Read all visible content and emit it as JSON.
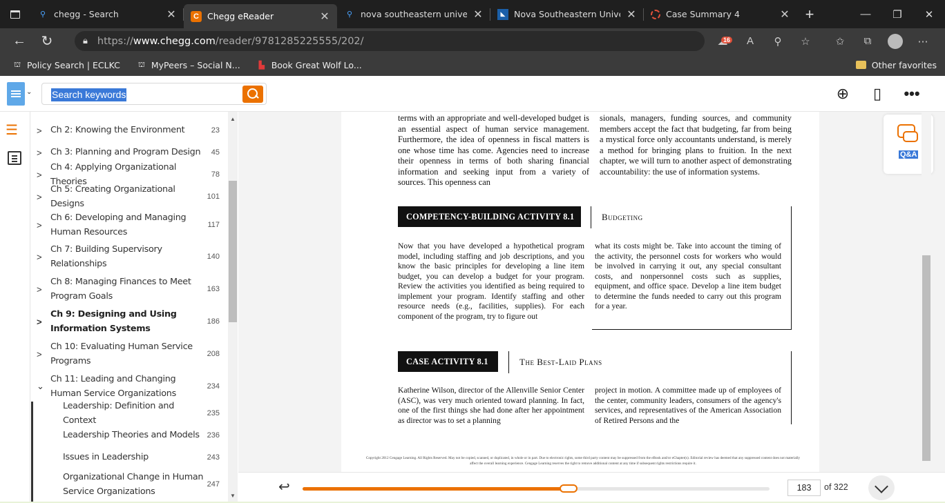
{
  "browser": {
    "tabs": [
      {
        "title": "chegg - Search",
        "icon": "search-icon",
        "active": false
      },
      {
        "title": "Chegg eReader",
        "icon": "chegg-logo-icon",
        "active": true
      },
      {
        "title": "nova southeastern university",
        "icon": "search-icon",
        "active": false
      },
      {
        "title": "Nova Southeastern University",
        "icon": "nsu-logo-icon",
        "active": false
      },
      {
        "title": "Case Summary 4",
        "icon": "loading-icon",
        "active": false
      }
    ],
    "url_prefix": "https://",
    "url_domain": "www.chegg.com",
    "url_path": "/reader/9781285225555/202/",
    "extension_badge": "16",
    "favorites": [
      {
        "label": "Policy Search | ECLKC"
      },
      {
        "label": "MyPeers – Social N..."
      },
      {
        "label": "Book Great Wolf Lo..."
      }
    ],
    "other_favorites": "Other favorites"
  },
  "reader": {
    "search_placeholder": "Search keywords",
    "toc": [
      {
        "label": "Ch 2: Knowing the Environment",
        "page": "23"
      },
      {
        "label": "Ch 3: Planning and Program Design",
        "page": "45"
      },
      {
        "label": "Ch 4: Applying Organizational Theories",
        "page": "78"
      },
      {
        "label": "Ch 5: Creating Organizational Designs",
        "page": "101"
      },
      {
        "label": "Ch 6: Developing and Managing Human Resources",
        "page": "117"
      },
      {
        "label": "Ch 7: Building Supervisory Relationships",
        "page": "140"
      },
      {
        "label": "Ch 8: Managing Finances to Meet Program Goals",
        "page": "163"
      },
      {
        "label": "Ch 9: Designing and Using Information Systems",
        "page": "186"
      },
      {
        "label": "Ch 10: Evaluating Human Service Programs",
        "page": "208"
      },
      {
        "label": "Ch 11: Leading and Changing Human Service Organizations",
        "page": "234"
      },
      {
        "label": "Leadership: Definition and Context",
        "page": "235"
      },
      {
        "label": "Leadership Theories and Models",
        "page": "236"
      },
      {
        "label": "Issues in Leadership",
        "page": "243"
      },
      {
        "label": "Organizational Change in Human Service Organizations",
        "page": "247"
      }
    ],
    "qa_label": "Q&A",
    "current_page": "183",
    "total_pages": "of 322",
    "progress": 0.57
  },
  "content": {
    "top_left": "terms with an appropriate and well-developed budget is an essential aspect of human service management. Furthermore, the idea of openness in fiscal matters is one whose time has come. Agencies need to increase their openness in terms of both sharing financial information and seeking input from a variety of sources. This openness can",
    "top_right": "sionals, managers, funding sources, and community members accept the fact that budgeting, far from being a mystical force only accountants understand, is merely a method for bringing plans to fruition. In the next chapter, we will turn to another aspect of demonstrating accountability: the use of information systems.",
    "box1_title": "COMPETENCY-BUILDING ACTIVITY 8.1",
    "box1_subtitle": "Budgeting",
    "box1_left": "Now that you have developed a hypothetical program model, including staffing and job descriptions, and you know the basic principles for developing a line item budget, you can develop a budget for your program. Review the activities you identified as being required to implement your program. Identify staffing and other resource needs (e.g., facilities, supplies). For each component of the program, try to figure out",
    "box1_right": "what its costs might be. Take into account the timing of the activity, the personnel costs for workers who would be involved in carrying it out, any special consultant costs, and nonpersonnel costs such as supplies, equipment, and office space. Develop a line item budget to determine the funds needed to carry out this program for a year.",
    "box2_title": "CASE ACTIVITY 8.1",
    "box2_subtitle": "The Best-Laid Plans",
    "box2_left": "Katherine Wilson, director of the Allenville Senior Center (ASC), was very much oriented toward planning. In fact, one of the first things she had done after her appointment as director was to set a planning",
    "box2_right": "project in motion. A committee made up of employees of the center, community leaders, consumers of the agency's services, and representatives of the American Association of Retired Persons and the",
    "copyright": "Copyright 2012 Cengage Learning. All Rights Reserved. May not be copied, scanned, or duplicated, in whole or in part. Due to electronic rights, some third party content may be suppressed from the eBook and/or eChapter(s). Editorial review has deemed that any suppressed content does not materially affect the overall learning experience. Cengage Learning reserves the right to remove additional content at any time if subsequent rights restrictions require it."
  }
}
